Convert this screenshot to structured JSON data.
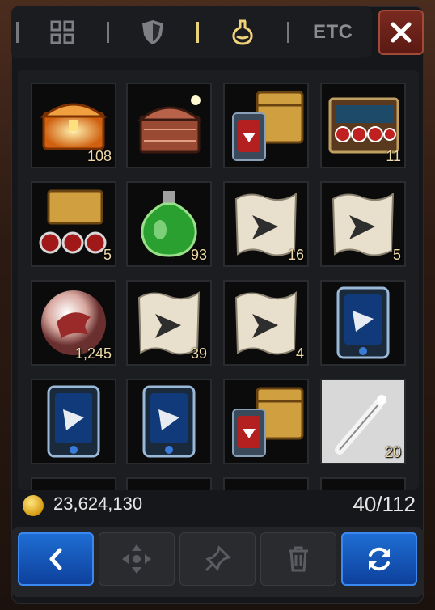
{
  "tabs": [
    {
      "name": "grid",
      "icon": "grid-icon"
    },
    {
      "name": "equipment",
      "icon": "shield-icon"
    },
    {
      "name": "consumables",
      "icon": "potion-icon",
      "active": true
    },
    {
      "name": "etc",
      "label": "ETC"
    }
  ],
  "inventory": {
    "items": [
      {
        "icon": "orange-chest-icon",
        "qty": "108"
      },
      {
        "icon": "copper-chest-icon",
        "qty": ""
      },
      {
        "icon": "card-chest-icon",
        "qty": ""
      },
      {
        "icon": "orb-chest-icon",
        "qty": "11"
      },
      {
        "icon": "gold-chest-orbs-icon",
        "qty": "5"
      },
      {
        "icon": "green-potion-icon",
        "qty": "93"
      },
      {
        "icon": "scroll-icon",
        "qty": "16"
      },
      {
        "icon": "scroll-icon",
        "qty": "5"
      },
      {
        "icon": "dragon-orb-icon",
        "qty": "1,245"
      },
      {
        "icon": "scroll-icon",
        "qty": "39"
      },
      {
        "icon": "scroll-icon",
        "qty": "4"
      },
      {
        "icon": "blue-card-icon",
        "qty": ""
      },
      {
        "icon": "blue-card-icon",
        "qty": ""
      },
      {
        "icon": "blue-card-icon",
        "qty": ""
      },
      {
        "icon": "card-chest-icon",
        "qty": ""
      },
      {
        "icon": "wand-icon",
        "qty": "20"
      }
    ]
  },
  "footer": {
    "gold": "23,624,130",
    "slots": "40/112"
  },
  "colors": {
    "accent": "#e8d27a",
    "blue": "#1f6fd6",
    "close": "#7a2a20"
  }
}
